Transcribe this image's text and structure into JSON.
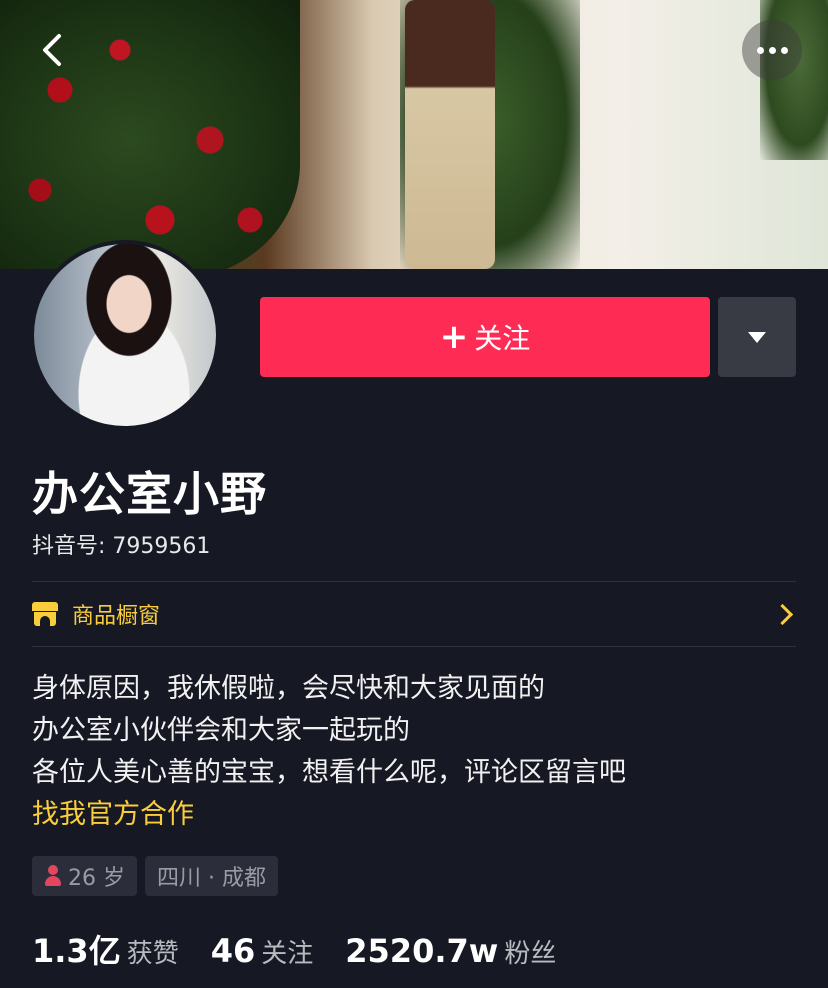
{
  "profile": {
    "nickname": "办公室小野",
    "douyin_id": "抖音号: 7959561",
    "follow_label": "关注",
    "follow_icon": "+"
  },
  "shop": {
    "label": "商品橱窗",
    "icon": "shop-icon"
  },
  "bio": {
    "lines": [
      "身体原因，我休假啦，会尽快和大家见面的",
      "办公室小伙伴会和大家一起玩的",
      "各位人美心善的宝宝，想看什么呢，评论区留言吧"
    ],
    "link": "找我官方合作"
  },
  "tags": {
    "age": "26 岁",
    "location": "四川 · 成都"
  },
  "stats": {
    "likes_num": "1.3亿",
    "likes_label": "获赞",
    "following_num": "46",
    "following_label": "关注",
    "followers_num": "2520.7w",
    "followers_label": "粉丝"
  },
  "colors": {
    "background": "#161823",
    "follow_button": "#fe2c55",
    "accent_yellow": "#facd3c"
  }
}
